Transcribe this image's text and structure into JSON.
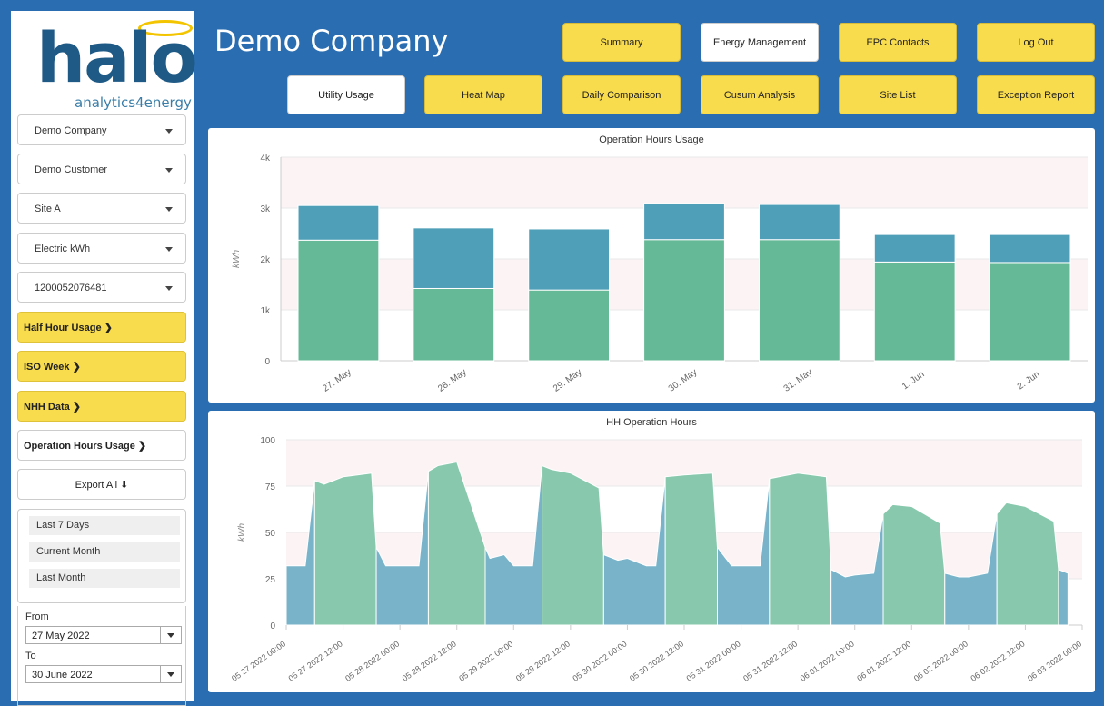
{
  "logo": {
    "wordmark": "halo",
    "tagline": "analytics4energy"
  },
  "sidebar": {
    "selects": [
      {
        "label": "Demo Company"
      },
      {
        "label": "Demo Customer"
      },
      {
        "label": "Site A"
      },
      {
        "label": "Electric kWh"
      },
      {
        "label": "1200052076481"
      }
    ],
    "buttons": {
      "half_hour": "Half Hour Usage ❯",
      "iso_week": "ISO Week ❯",
      "nhh": "NHH Data ❯",
      "op_hours": "Operation Hours Usage ❯",
      "export_all": "Export All ⬇"
    },
    "ranges": [
      "Last 7 Days",
      "Current Month",
      "Last Month"
    ],
    "from_label": "From",
    "from_value": "27 May 2022",
    "to_label": "To",
    "to_value": "30 June 2022"
  },
  "header": {
    "company": "Demo Company",
    "nav_row1": [
      "Summary",
      "Energy Management",
      "EPC Contacts",
      "Log Out"
    ],
    "nav_row2": [
      "Utility Usage",
      "Heat Map",
      "Daily Comparison",
      "Cusum Analysis",
      "Site List",
      "Exception Report"
    ]
  },
  "colors": {
    "yellow": "#f9dc4d",
    "blue_bg": "#2a6db0",
    "teal": "#4f9fb8",
    "green": "#65b996",
    "area_blue": "#78b3c9",
    "area_green": "#88c9ad"
  },
  "chart_data": [
    {
      "type": "bar",
      "title": "Operation Hours Usage",
      "ylabel": "kWh",
      "ylim": [
        0,
        4000
      ],
      "yticks": [
        "0",
        "1k",
        "2k",
        "3k",
        "4k"
      ],
      "categories": [
        "27. May",
        "28. May",
        "29. May",
        "30. May",
        "31. May",
        "1. Jun",
        "2. Jun"
      ],
      "stacked": true,
      "series": [
        {
          "values": [
            2370,
            1420,
            1390,
            2380,
            2380,
            1940,
            1930
          ]
        },
        {
          "values": [
            680,
            1190,
            1200,
            710,
            690,
            540,
            550
          ]
        }
      ]
    },
    {
      "type": "area",
      "title": "HH Operation Hours",
      "ylabel": "kWh",
      "ylim": [
        0,
        100
      ],
      "yticks": [
        "0",
        "25",
        "50",
        "75",
        "100"
      ],
      "xticks": [
        "05 27 2022 00:00",
        "05 27 2022 12:00",
        "05 28 2022 00:00",
        "05 28 2022 12:00",
        "05 29 2022 00:00",
        "05 29 2022 12:00",
        "05 30 2022 00:00",
        "05 30 2022 12:00",
        "05 31 2022 00:00",
        "05 31 2022 12:00",
        "06 01 2022 00:00",
        "06 01 2022 12:00",
        "06 02 2022 00:00",
        "06 02 2022 12:00",
        "06 03 2022 00:00"
      ],
      "x_hours": [
        0,
        4,
        6,
        8,
        12,
        18,
        19,
        21,
        24,
        28,
        30,
        32,
        36,
        42,
        43,
        46,
        48,
        52,
        54,
        56,
        60,
        66,
        67,
        70,
        72,
        76,
        78,
        80,
        84,
        90,
        91,
        94,
        96,
        100,
        102,
        104,
        108,
        114,
        115,
        118,
        120,
        124,
        126,
        128,
        132,
        138,
        139,
        142,
        144,
        148,
        150,
        152,
        156,
        162,
        163,
        165
      ],
      "y_values": [
        32,
        32,
        78,
        76,
        80,
        82,
        42,
        32,
        32,
        32,
        83,
        86,
        88,
        42,
        36,
        38,
        32,
        32,
        86,
        84,
        82,
        74,
        38,
        35,
        36,
        32,
        32,
        80,
        81,
        82,
        42,
        32,
        32,
        32,
        79,
        80,
        82,
        80,
        30,
        26,
        27,
        28,
        60,
        65,
        64,
        55,
        28,
        26,
        26,
        28,
        60,
        66,
        64,
        56,
        30,
        28
      ],
      "operating": [
        false,
        false,
        true,
        true,
        true,
        true,
        false,
        false,
        false,
        false,
        true,
        true,
        true,
        false,
        false,
        false,
        false,
        false,
        true,
        true,
        true,
        true,
        false,
        false,
        false,
        false,
        false,
        true,
        true,
        true,
        false,
        false,
        false,
        false,
        true,
        true,
        true,
        true,
        false,
        false,
        false,
        false,
        true,
        true,
        true,
        true,
        false,
        false,
        false,
        false,
        true,
        true,
        true,
        true,
        false,
        false
      ]
    }
  ]
}
